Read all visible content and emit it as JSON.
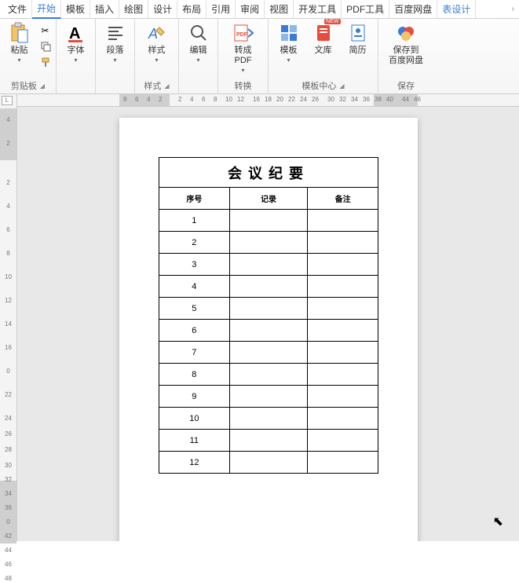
{
  "menu": {
    "items": [
      "文件",
      "开始",
      "模板",
      "插入",
      "绘图",
      "设计",
      "布局",
      "引用",
      "审阅",
      "视图",
      "开发工具",
      "PDF工具",
      "百度网盘"
    ],
    "active": 1,
    "extra": "表设计"
  },
  "ribbon": {
    "clipboard": {
      "paste": "粘贴",
      "title": "剪贴板"
    },
    "font": {
      "label": "字体"
    },
    "para": {
      "label": "段落"
    },
    "style": {
      "label": "样式",
      "title": "样式"
    },
    "edit": {
      "label": "编辑"
    },
    "pdf": {
      "label": "转成PDF",
      "title": "转换"
    },
    "tplcenter": {
      "tpl": "模板",
      "lib": "文库",
      "resume": "简历",
      "title": "模板中心",
      "new": "NEW"
    },
    "save": {
      "label": "保存到\n百度网盘",
      "title": "保存"
    }
  },
  "vruler": {
    "tab": "L",
    "shades": [
      [
        18,
        66
      ],
      [
        492,
        80
      ]
    ],
    "ticks": [
      {
        "p": 28,
        "t": "4"
      },
      {
        "p": 58,
        "t": "2"
      },
      {
        "p": 108,
        "t": "2"
      },
      {
        "p": 138,
        "t": "4"
      },
      {
        "p": 168,
        "t": "6"
      },
      {
        "p": 198,
        "t": "8"
      },
      {
        "p": 228,
        "t": "10"
      },
      {
        "p": 258,
        "t": "12"
      },
      {
        "p": 288,
        "t": "14"
      },
      {
        "p": 318,
        "t": "16"
      },
      {
        "p": 348,
        "t": "0"
      },
      {
        "p": 378,
        "t": "22"
      },
      {
        "p": 408,
        "t": "24"
      },
      {
        "p": 428,
        "t": "26"
      },
      {
        "p": 448,
        "t": "28"
      },
      {
        "p": 468,
        "t": "30"
      },
      {
        "p": 486,
        "t": "32"
      },
      {
        "p": 504,
        "t": "34"
      },
      {
        "p": 522,
        "t": "36"
      },
      {
        "p": 540,
        "t": "0"
      },
      {
        "p": 558,
        "t": "42"
      },
      {
        "p": 576,
        "t": "44"
      },
      {
        "p": 594,
        "t": "46"
      },
      {
        "p": 612,
        "t": "48"
      }
    ]
  },
  "hruler": {
    "shades": [
      [
        130,
        64
      ],
      [
        454,
        56
      ]
    ],
    "ticks": [
      {
        "p": 135,
        "t": "8"
      },
      {
        "p": 150,
        "t": "6"
      },
      {
        "p": 165,
        "t": "4"
      },
      {
        "p": 180,
        "t": "2"
      },
      {
        "p": 205,
        "t": "2"
      },
      {
        "p": 220,
        "t": "4"
      },
      {
        "p": 235,
        "t": "6"
      },
      {
        "p": 250,
        "t": "8"
      },
      {
        "p": 265,
        "t": "10"
      },
      {
        "p": 280,
        "t": "12"
      },
      {
        "p": 300,
        "t": "16"
      },
      {
        "p": 315,
        "t": "18"
      },
      {
        "p": 330,
        "t": "20"
      },
      {
        "p": 345,
        "t": "22"
      },
      {
        "p": 360,
        "t": "24"
      },
      {
        "p": 375,
        "t": "26"
      },
      {
        "p": 395,
        "t": "30"
      },
      {
        "p": 410,
        "t": "32"
      },
      {
        "p": 425,
        "t": "34"
      },
      {
        "p": 440,
        "t": "36"
      },
      {
        "p": 455,
        "t": "38"
      },
      {
        "p": 470,
        "t": "40"
      },
      {
        "p": 490,
        "t": "44"
      },
      {
        "p": 505,
        "t": "46"
      }
    ]
  },
  "doc": {
    "title": "会议纪要",
    "headers": [
      "序号",
      "记录",
      "备注"
    ],
    "rows": [
      [
        "1",
        "",
        ""
      ],
      [
        "2",
        "",
        ""
      ],
      [
        "3",
        "",
        ""
      ],
      [
        "4",
        "",
        ""
      ],
      [
        "5",
        "",
        ""
      ],
      [
        "6",
        "",
        ""
      ],
      [
        "7",
        "",
        ""
      ],
      [
        "8",
        "",
        ""
      ],
      [
        "9",
        "",
        ""
      ],
      [
        "10",
        "",
        ""
      ],
      [
        "11",
        "",
        ""
      ],
      [
        "12",
        "",
        ""
      ]
    ]
  }
}
